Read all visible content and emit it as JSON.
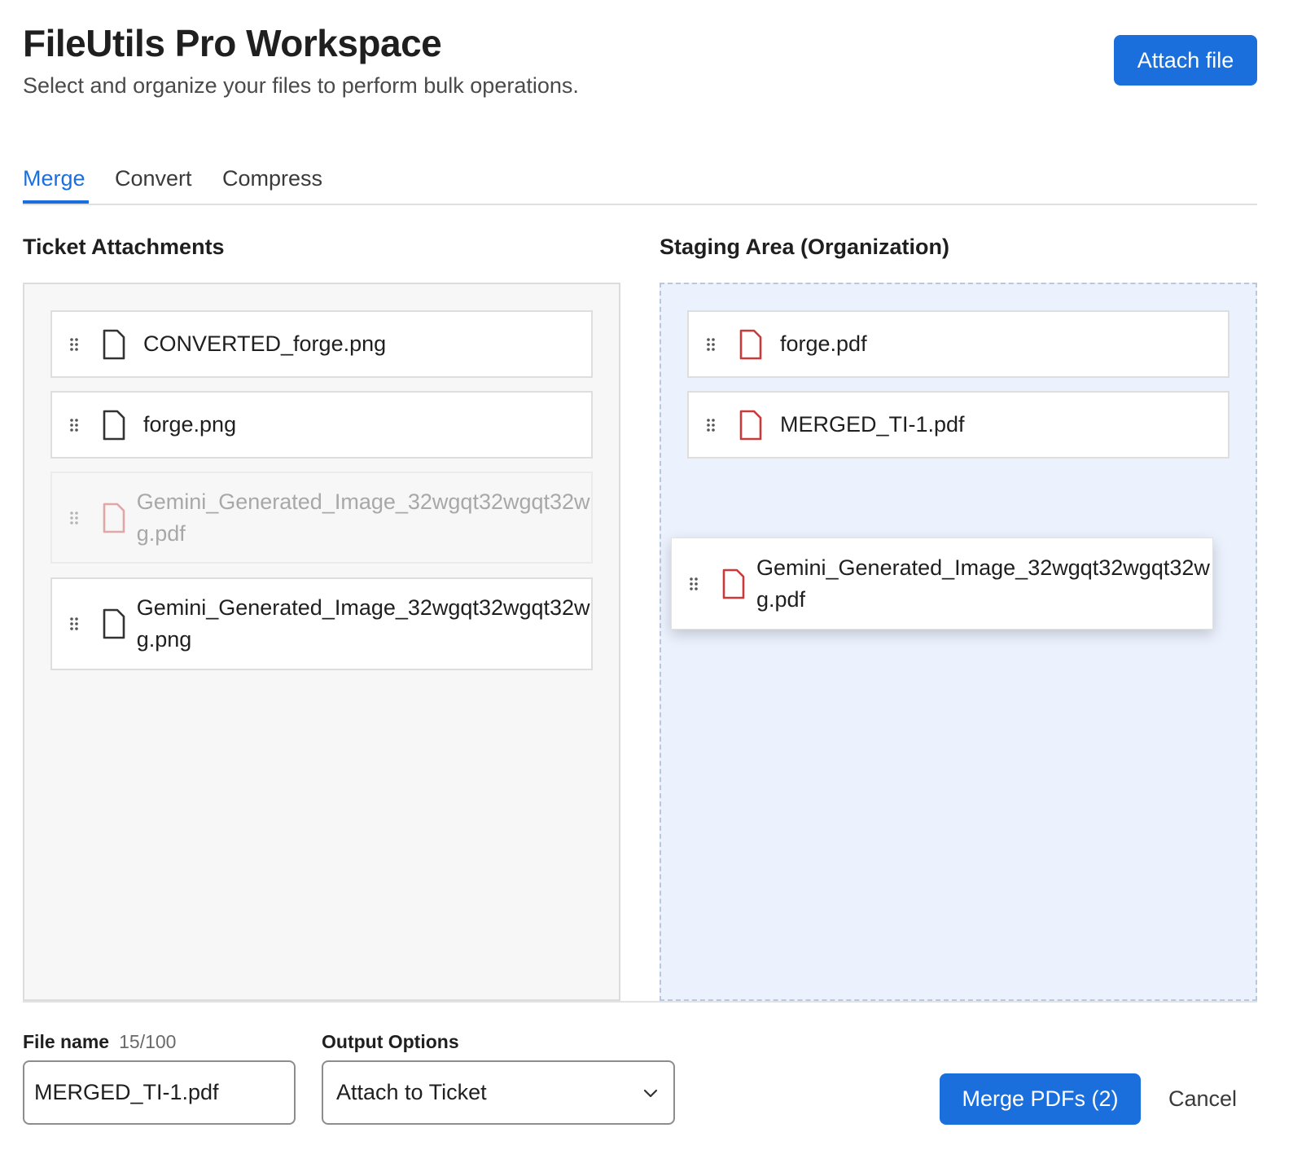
{
  "header": {
    "title": "FileUtils Pro Workspace",
    "subtitle": "Select and organize your files to perform bulk operations.",
    "attach_label": "Attach file"
  },
  "tabs": [
    {
      "label": "Merge",
      "active": true
    },
    {
      "label": "Convert",
      "active": false
    },
    {
      "label": "Compress",
      "active": false
    }
  ],
  "attachments": {
    "title": "Ticket Attachments",
    "items": [
      {
        "name": "CONVERTED_forge.png",
        "type": "file-icon",
        "state": "normal"
      },
      {
        "name": "forge.png",
        "type": "file-icon",
        "state": "normal"
      },
      {
        "name": "Gemini_Generated_Image_32wgqt32wgqt32wg.pdf",
        "type": "pdf-icon",
        "state": "ghost"
      },
      {
        "name": "Gemini_Generated_Image_32wgqt32wgqt32wg.png",
        "type": "file-icon",
        "state": "normal"
      }
    ]
  },
  "staging": {
    "title": "Staging Area (Organization)",
    "items": [
      {
        "name": "forge.pdf",
        "type": "pdf-icon"
      },
      {
        "name": "MERGED_TI-1.pdf",
        "type": "pdf-icon"
      }
    ],
    "dragging": {
      "name": "Gemini_Generated_Image_32wgqt32wgqt32wg.pdf",
      "type": "pdf-icon"
    }
  },
  "footer": {
    "filename_label": "File name",
    "filename_counter": "15/100",
    "filename_value": "MERGED_TI-1.pdf",
    "output_label": "Output Options",
    "output_value": "Attach to Ticket",
    "merge_label": "Merge PDFs (2)",
    "cancel_label": "Cancel"
  },
  "colors": {
    "accent": "#1a6fdc",
    "pdf_red": "#c93a3a",
    "staging_bg": "#ebf1fd"
  }
}
